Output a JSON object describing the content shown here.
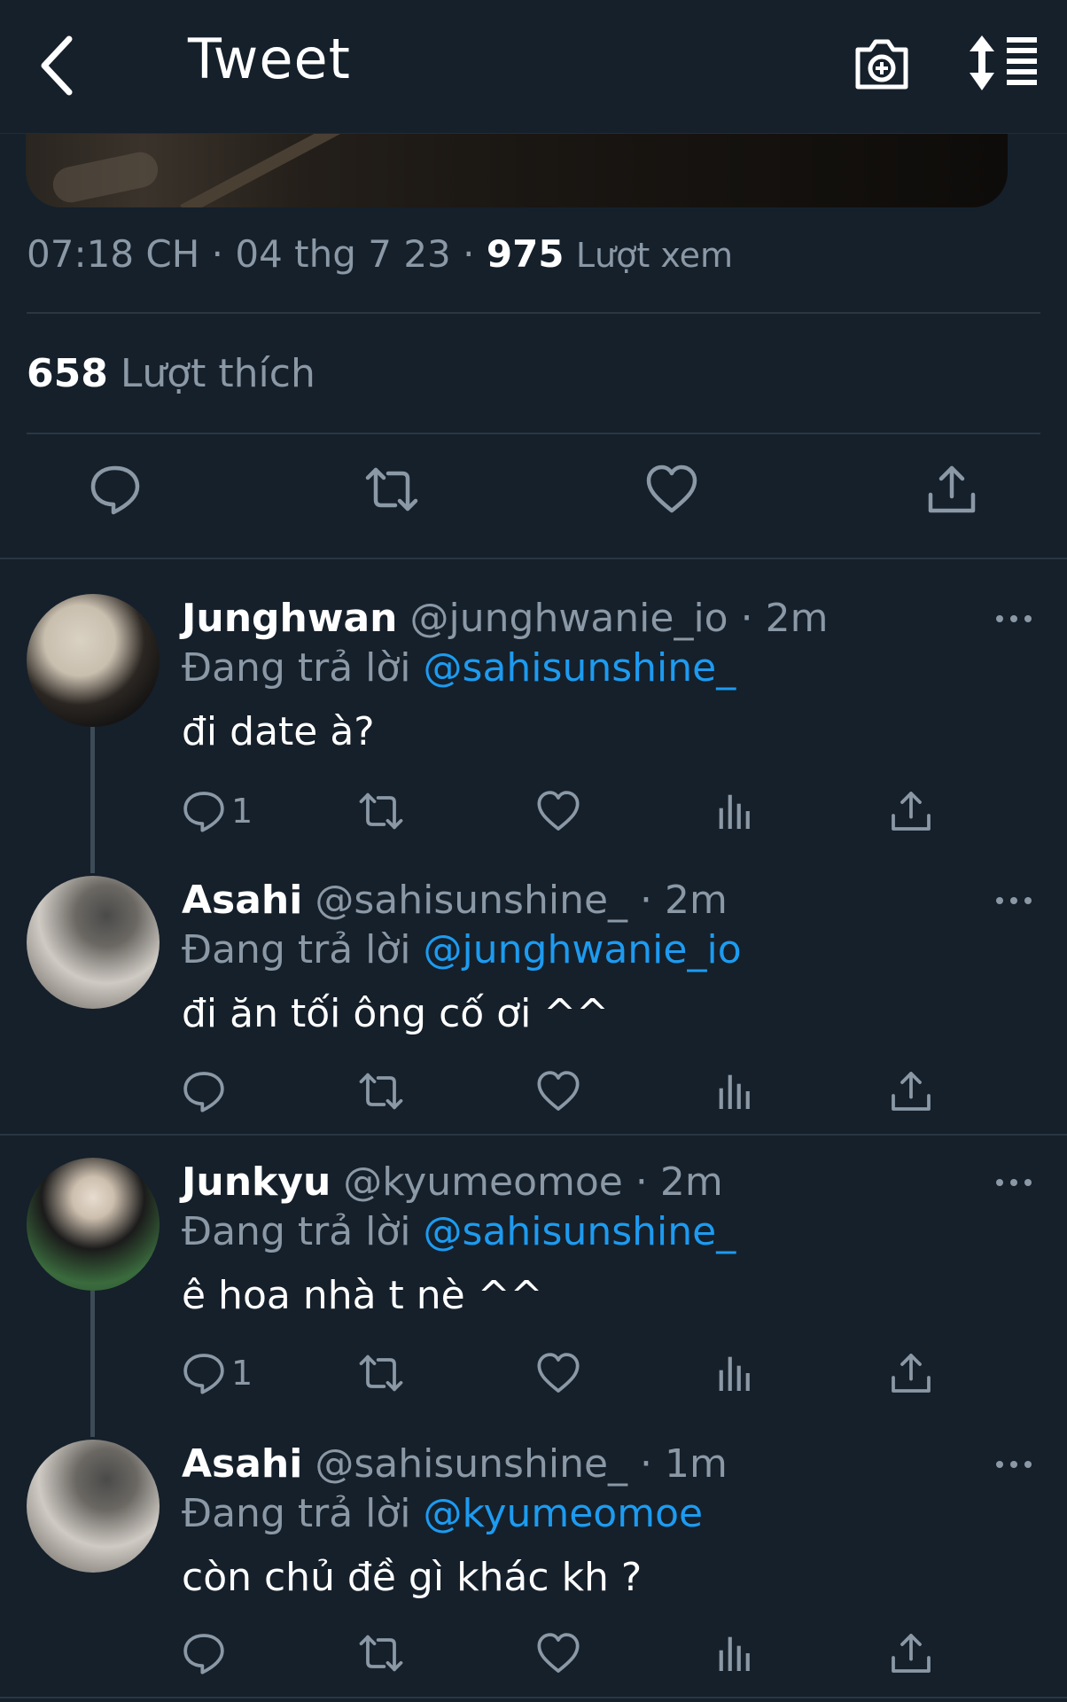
{
  "header": {
    "title": "Tweet"
  },
  "tweet": {
    "time": "07:18 CH",
    "date": "04 thg 7 23",
    "views": "975",
    "views_label": "Lượt xem",
    "likes": "658",
    "likes_label": "Lượt thích"
  },
  "replies": [
    {
      "name": "Junghwan",
      "handle": "@junghwanie_io",
      "time": "2m",
      "replying_label": "Đang trả lời",
      "replying_to": "@sahisunshine_",
      "text": "đi date à?",
      "reply_count": "1"
    },
    {
      "name": "Asahi",
      "handle": "@sahisunshine_",
      "time": "2m",
      "replying_label": "Đang trả lời",
      "replying_to": "@junghwanie_io",
      "text": "đi ăn tối ông cố ơi ^^",
      "reply_count": ""
    },
    {
      "name": "Junkyu",
      "handle": "@kyumeomoe",
      "time": "2m",
      "replying_label": "Đang trả lời",
      "replying_to": "@sahisunshine_",
      "text": "ê hoa nhà t nè ^^",
      "reply_count": "1"
    },
    {
      "name": "Asahi",
      "handle": "@sahisunshine_",
      "time": "1m",
      "replying_label": "Đang trả lời",
      "replying_to": "@kyumeomoe",
      "text": "còn chủ đề gì khác kh ?",
      "reply_count": ""
    }
  ],
  "colors": {
    "background": "#15202b",
    "secondary_text": "#8b98a5",
    "mention": "#1d9bf0",
    "divider": "#2a3641"
  }
}
